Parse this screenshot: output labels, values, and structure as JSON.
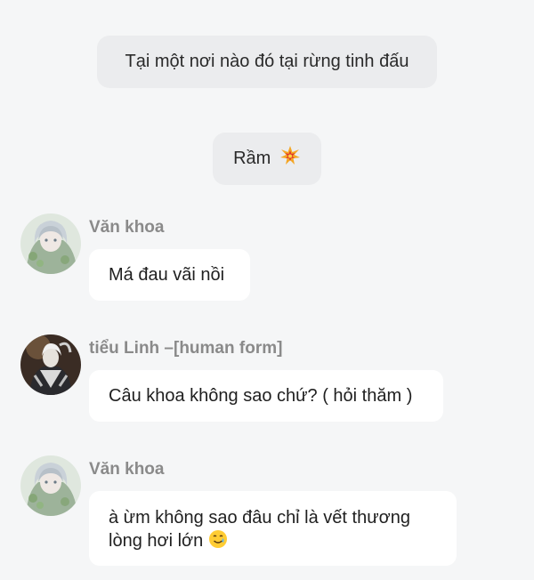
{
  "narrations": [
    {
      "text": "Tại một nơi nào đó tại rừng tinh đấu"
    },
    {
      "text": "Rầm",
      "emoji": "collision-icon"
    }
  ],
  "messages": [
    {
      "sender": "Văn khoa",
      "avatar": "avatar-van-khoa",
      "text": "Má đau vãi nồi"
    },
    {
      "sender": "tiểu Linh –[human form]",
      "avatar": "avatar-tieu-linh",
      "text": "Câu khoa không sao chứ? ( hỏi thăm )"
    },
    {
      "sender": "Văn khoa",
      "avatar": "avatar-van-khoa",
      "text_line1": "à ừm không sao đâu chỉ là vết thương",
      "text_line2": "lòng hơi lớn",
      "emoji": "smiling-face-with-tear-icon"
    }
  ],
  "colors": {
    "background": "#f5f6f7",
    "narration_bg": "#ebecee",
    "bubble_bg": "#ffffff",
    "sender_text": "#8a8a8a"
  }
}
